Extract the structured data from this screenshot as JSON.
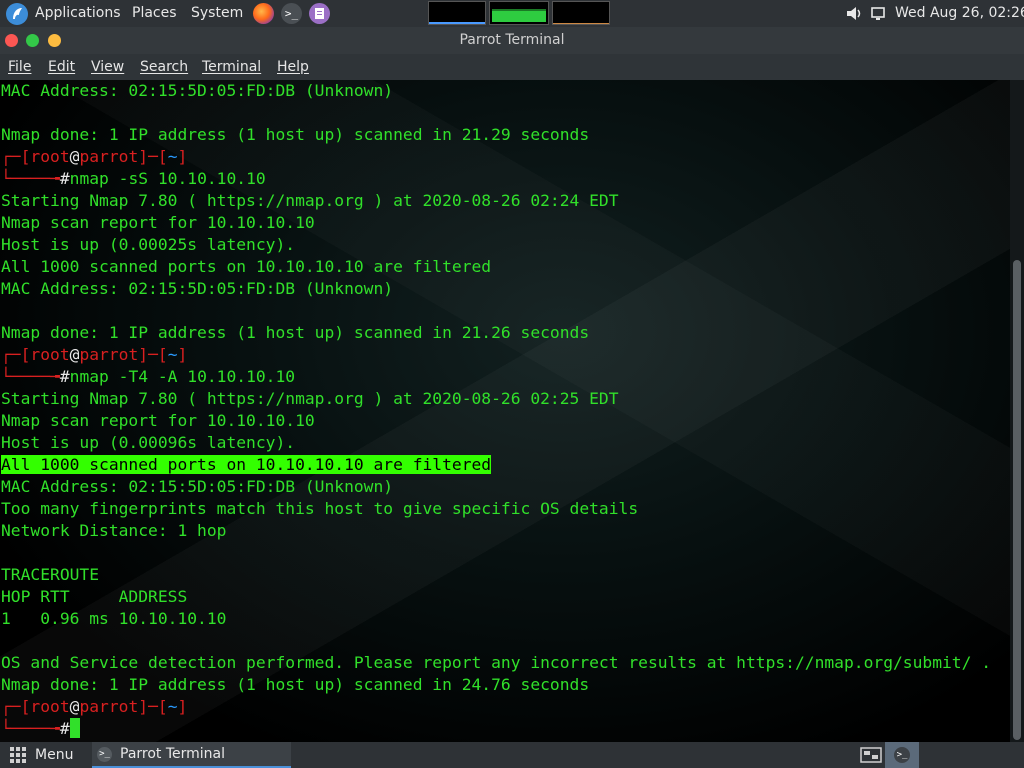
{
  "top_panel": {
    "applications_label": "Applications",
    "places_label": "Places",
    "system_label": "System",
    "clock": "Wed Aug 26, 02:26",
    "launchers": [
      "firefox-icon",
      "terminal-icon",
      "text-editor-icon"
    ]
  },
  "window": {
    "title": "Parrot Terminal"
  },
  "menubar": {
    "items": [
      "File",
      "Edit",
      "View",
      "Search",
      "Terminal",
      "Help"
    ]
  },
  "terminal": {
    "lines": [
      {
        "kind": "text",
        "text": "MAC Address: 02:15:5D:05:FD:DB (Unknown)"
      },
      {
        "kind": "blank"
      },
      {
        "kind": "text",
        "text": "Nmap done: 1 IP address (1 host up) scanned in 21.29 seconds"
      },
      {
        "kind": "prompt",
        "user": "root",
        "host": "parrot",
        "dir": "~"
      },
      {
        "kind": "cmd",
        "text": "nmap -sS 10.10.10.10"
      },
      {
        "kind": "text",
        "text": "Starting Nmap 7.80 ( https://nmap.org ) at 2020-08-26 02:24 EDT"
      },
      {
        "kind": "text",
        "text": "Nmap scan report for 10.10.10.10"
      },
      {
        "kind": "text",
        "text": "Host is up (0.00025s latency)."
      },
      {
        "kind": "text",
        "text": "All 1000 scanned ports on 10.10.10.10 are filtered"
      },
      {
        "kind": "text",
        "text": "MAC Address: 02:15:5D:05:FD:DB (Unknown)"
      },
      {
        "kind": "blank"
      },
      {
        "kind": "text",
        "text": "Nmap done: 1 IP address (1 host up) scanned in 21.26 seconds"
      },
      {
        "kind": "prompt",
        "user": "root",
        "host": "parrot",
        "dir": "~"
      },
      {
        "kind": "cmd",
        "text": "nmap -T4 -A 10.10.10.10"
      },
      {
        "kind": "text",
        "text": "Starting Nmap 7.80 ( https://nmap.org ) at 2020-08-26 02:25 EDT"
      },
      {
        "kind": "text",
        "text": "Nmap scan report for 10.10.10.10"
      },
      {
        "kind": "text",
        "text": "Host is up (0.00096s latency)."
      },
      {
        "kind": "text",
        "text": "All 1000 scanned ports on 10.10.10.10 are filtered",
        "highlight": true
      },
      {
        "kind": "text",
        "text": "MAC Address: 02:15:5D:05:FD:DB (Unknown)"
      },
      {
        "kind": "text",
        "text": "Too many fingerprints match this host to give specific OS details"
      },
      {
        "kind": "text",
        "text": "Network Distance: 1 hop"
      },
      {
        "kind": "blank"
      },
      {
        "kind": "text",
        "text": "TRACEROUTE"
      },
      {
        "kind": "text",
        "text": "HOP RTT     ADDRESS"
      },
      {
        "kind": "text",
        "text": "1   0.96 ms 10.10.10.10"
      },
      {
        "kind": "blank"
      },
      {
        "kind": "text",
        "text": "OS and Service detection performed. Please report any incorrect results at https://nmap.org/submit/ ."
      },
      {
        "kind": "text",
        "text": "Nmap done: 1 IP address (1 host up) scanned in 24.76 seconds"
      },
      {
        "kind": "prompt",
        "user": "root",
        "host": "parrot",
        "dir": "~"
      },
      {
        "kind": "cursor"
      }
    ]
  },
  "bottom_panel": {
    "menu_label": "Menu",
    "task_label": "Parrot Terminal"
  },
  "colors": {
    "terminal_green": "#31e02a",
    "highlight_green": "#33ff00",
    "prompt_red": "#d82020"
  }
}
